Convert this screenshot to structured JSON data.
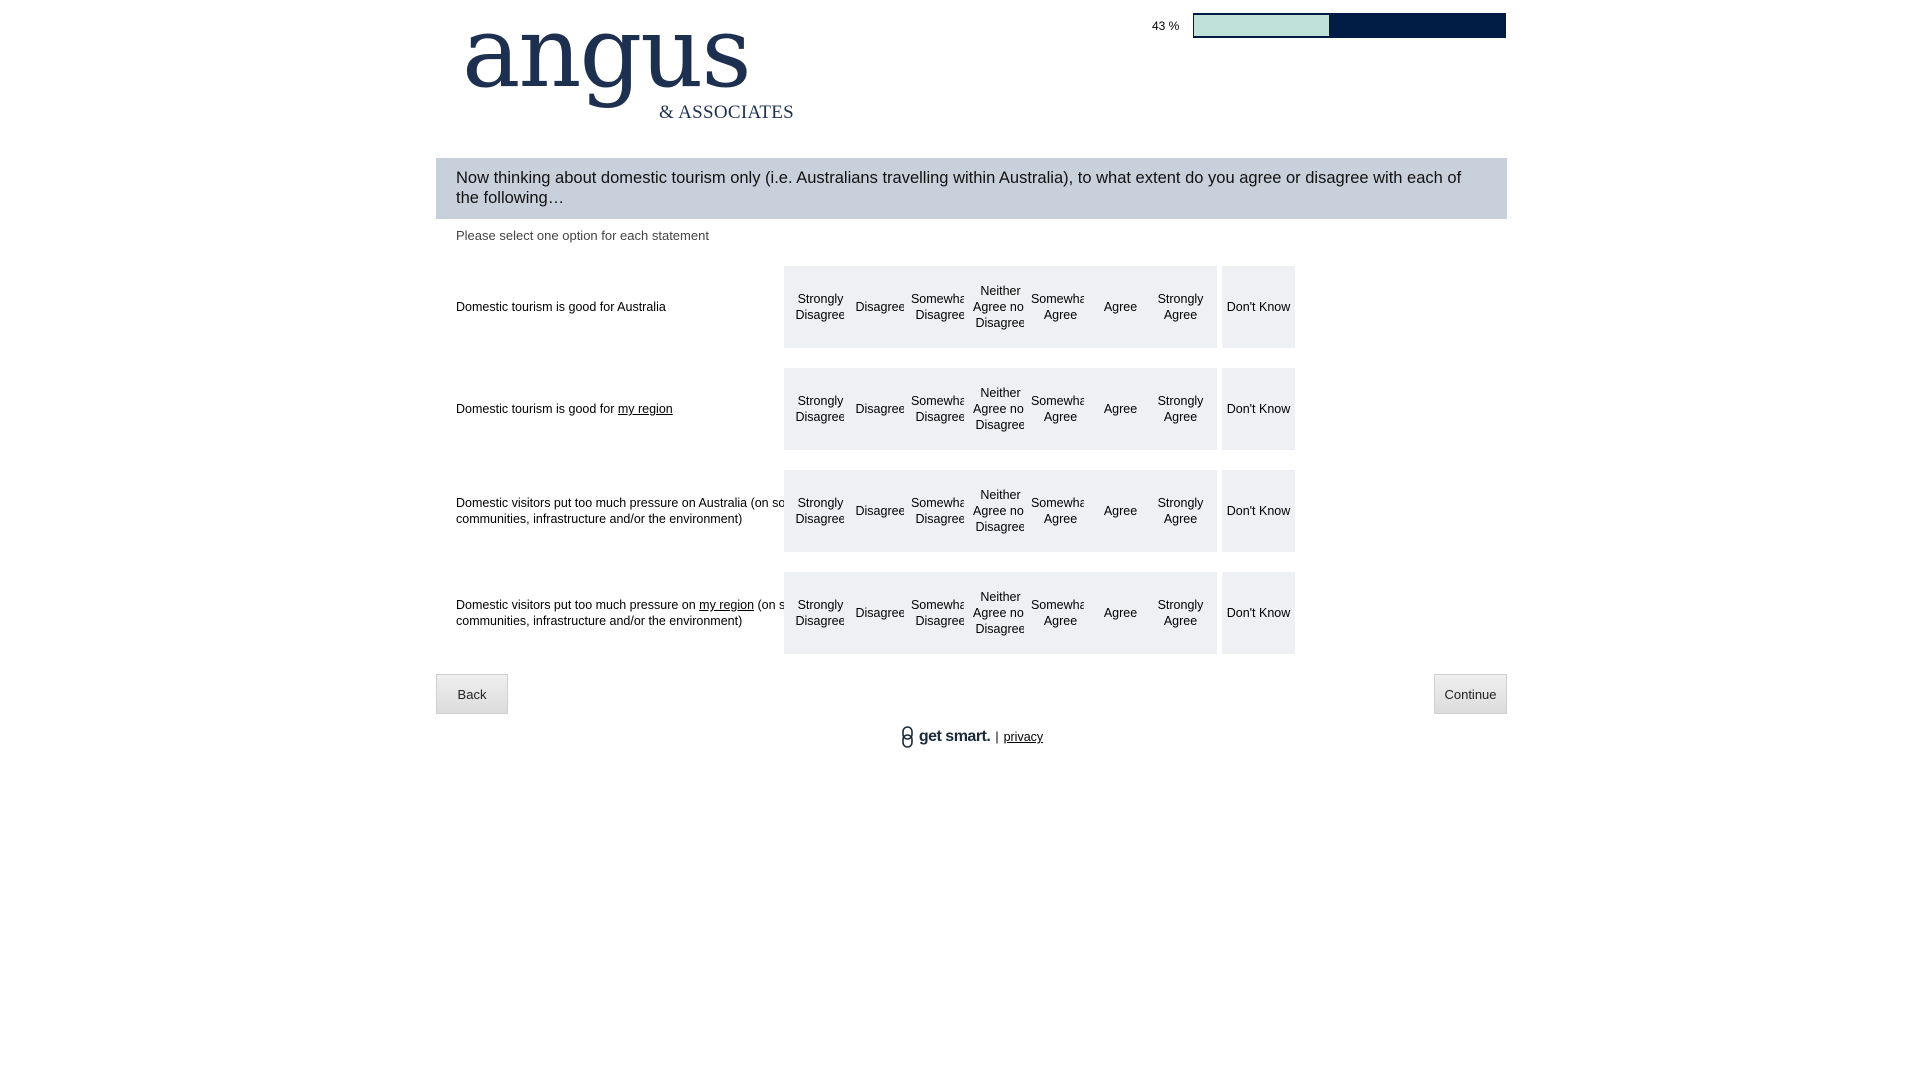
{
  "logo": {
    "word": "angus",
    "sub": "& ASSOCIATES"
  },
  "progress": {
    "label": "43 %",
    "fraction": 0.43
  },
  "question": {
    "text": "Now thinking about domestic tourism only (i.e. Australians travelling within Australia), to what extent do you agree or disagree with each of the following…",
    "instruction": "Please select one option for each statement"
  },
  "scale": {
    "options": [
      "Strongly Disagree",
      "Disagree",
      "Somewhat Disagree",
      "Neither Agree nor Disagree",
      "Somewhat Agree",
      "Agree",
      "Strongly Agree",
      "Don't Know"
    ]
  },
  "statements": [
    {
      "before": "Domestic tourism is good for Australia",
      "underline": "",
      "after": ""
    },
    {
      "before": "Domestic tourism is good for ",
      "underline": "my region",
      "after": ""
    },
    {
      "before": "Domestic visitors put too much pressure on Australia (on society, communities, infrastructure and/or the environment)",
      "underline": "",
      "after": ""
    },
    {
      "before": "Domestic visitors put too much pressure on ",
      "underline": "my region",
      "after": " (on society, communities, infrastructure and/or the environment)"
    }
  ],
  "nav": {
    "back_label": "Back",
    "continue_label": "Continue"
  },
  "footer": {
    "brand": "get smart.",
    "separator": "|",
    "privacy_label": "privacy"
  }
}
